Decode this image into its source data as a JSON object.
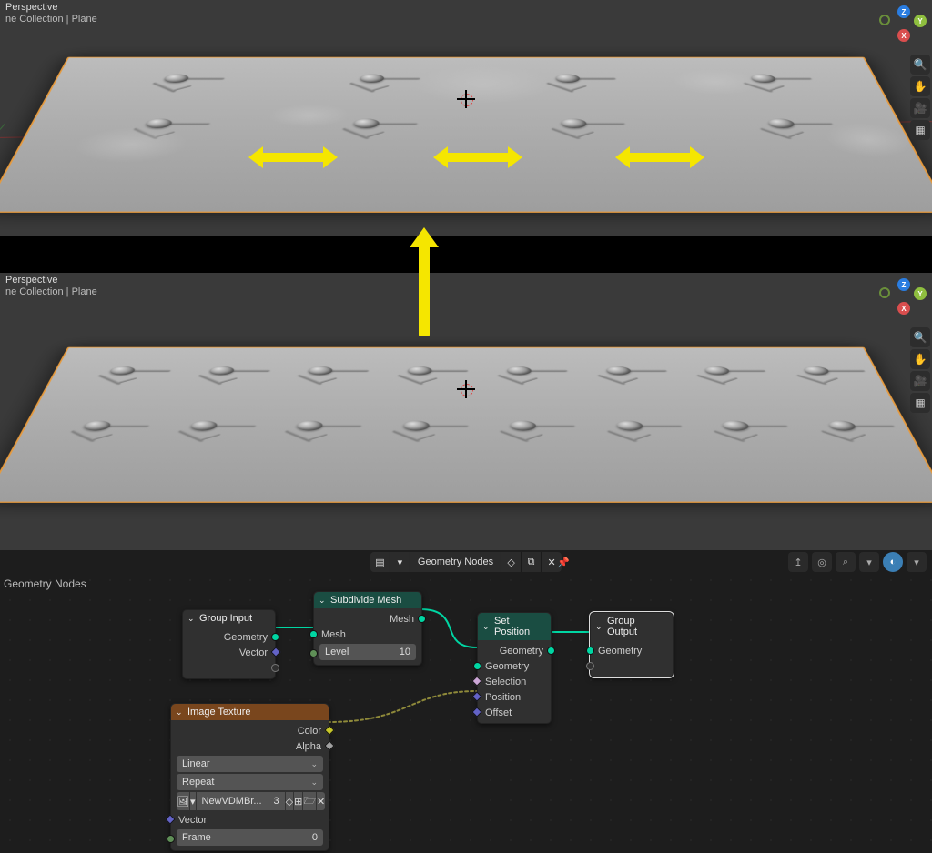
{
  "viewport": {
    "header_l1": "Perspective",
    "header_l2": "ne Collection | Plane",
    "gizmo": {
      "x": "X",
      "y": "Y",
      "z": "Z"
    }
  },
  "editor": {
    "toolbar": {
      "mode_label": "Geometry Nodes",
      "breadcrumb": "Geometry Nodes"
    },
    "nodes": {
      "group_input": {
        "title": "Group Input",
        "socket_geometry": "Geometry",
        "socket_vector": "Vector"
      },
      "subdivide_mesh": {
        "title": "Subdivide Mesh",
        "out_mesh": "Mesh",
        "in_mesh": "Mesh",
        "in_level_label": "Level",
        "in_level_value": "10"
      },
      "set_position": {
        "title": "Set Position",
        "out_geometry": "Geometry",
        "in_geometry": "Geometry",
        "in_selection": "Selection",
        "in_position": "Position",
        "in_offset": "Offset"
      },
      "group_output": {
        "title": "Group Output",
        "in_geometry": "Geometry"
      },
      "image_texture": {
        "title": "Image Texture",
        "out_color": "Color",
        "out_alpha": "Alpha",
        "interp": "Linear",
        "extension": "Repeat",
        "image_name": "NewVDMBr...",
        "users": "3",
        "in_vector": "Vector",
        "frame_label": "Frame",
        "frame_value": "0"
      }
    }
  }
}
